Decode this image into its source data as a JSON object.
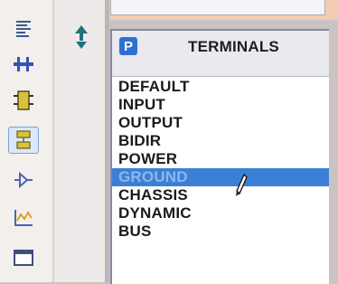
{
  "toolbar": {
    "tools": [
      {
        "icon": "text-script-icon",
        "active": false
      },
      {
        "icon": "bus-icon",
        "active": false
      },
      {
        "icon": "subcircuit-icon",
        "active": false
      },
      {
        "icon": "terminals-mode-icon",
        "active": true
      },
      {
        "icon": "device-pin-icon",
        "active": false
      },
      {
        "icon": "graph-icon",
        "active": false
      },
      {
        "icon": "tape-recorder-icon",
        "active": false
      }
    ]
  },
  "selector": {
    "badge": "P",
    "title": "TERMINALS",
    "items": [
      "DEFAULT",
      "INPUT",
      "OUTPUT",
      "BIDIR",
      "POWER",
      "GROUND",
      "CHASSIS",
      "DYNAMIC",
      "BUS"
    ],
    "selected_index": 5
  },
  "colors": {
    "selection": "#3b80d6",
    "badge": "#2f6fd0",
    "top_band": "#f1cdb3"
  }
}
